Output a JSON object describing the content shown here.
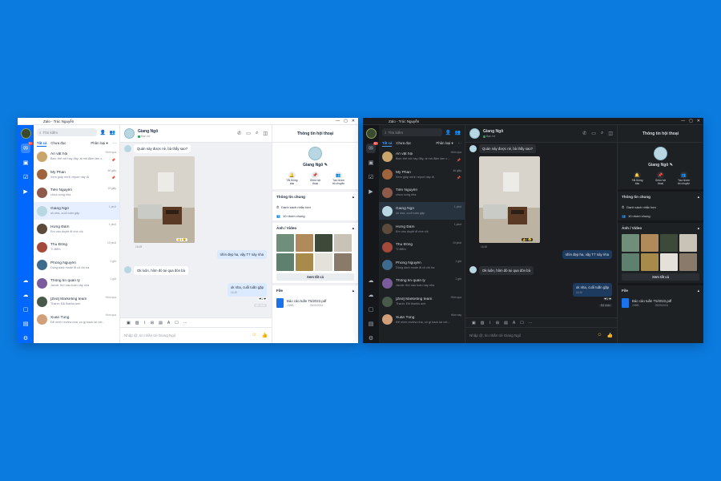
{
  "app_title": "Zalo - Trúc Nguyễn",
  "search_placeholder": "Tìm kiếm",
  "tabs": {
    "all": "Tất cả",
    "unread": "Chưa đọc",
    "classify": "Phân loại"
  },
  "light_conversations": [
    {
      "name": "Ăn vặt hội",
      "preview": "Bạn: thế nói hay đây, ai mà đâm làm c...",
      "time": "Hôm qua",
      "pinned": true,
      "avatar": "#c9a56b"
    },
    {
      "name": "My Phan",
      "preview": "Xem giúp mình report này đi",
      "time": "46 giây",
      "pinned": true,
      "avatar": "#a0643c"
    },
    {
      "name": "Tiến Nguyễn",
      "preview": "chưa xong nha",
      "time": "19 giây",
      "pinned": false,
      "avatar": "#8e5a4a"
    },
    {
      "name": "Giang Ngô",
      "preview": "ok nha, cuối tuần gặp",
      "time": "1 phút",
      "pinned": false,
      "avatar": "#b9d7e2",
      "active": true
    },
    {
      "name": "Hưng Đàm",
      "preview": "Em vào duyệt đi nhé chị",
      "time": "1 phút",
      "pinned": false,
      "avatar": "#5c4b3c"
    },
    {
      "name": "Thu Đồng",
      "preview": "Tí điểm",
      "time": "10 phút",
      "pinned": false,
      "avatar": "#a34a3c"
    },
    {
      "name": "Phong Nguyễn",
      "preview": "Dùng dark mode đi cô chị ba",
      "time": "1 giờ",
      "pinned": false,
      "avatar": "#3e6a8c"
    },
    {
      "name": "Thông tin quản lý",
      "preview": "Jacob: thứ sáu tuần này nha",
      "time": "1 giờ",
      "pinned": false,
      "avatar": "#7a5c9c"
    },
    {
      "name": "[Zed] Marketing team",
      "preview": "Thanh: Đã thanks anh",
      "time": "Hôm qua",
      "pinned": false,
      "avatar": "#4a5a4a"
    },
    {
      "name": "Xuân Tùng",
      "preview": "Để mình review nha, có gì back lại với...",
      "time": "Hôm qua",
      "pinned": false,
      "avatar": "#d1a07a"
    }
  ],
  "dark_conversations": [
    {
      "name": "Ăn vặt hội",
      "preview": "Bạn: thế nói hay đây, ai mà đâm làm c...",
      "time": "Hôm qua",
      "pinned": true,
      "avatar": "#c9a56b"
    },
    {
      "name": "My Phan",
      "preview": "Xem giúp mình report này đi",
      "time": "46 giây",
      "pinned": true,
      "avatar": "#a0643c"
    },
    {
      "name": "Tiến Nguyễn",
      "preview": "chưa xong nha",
      "time": "",
      "pinned": false,
      "avatar": "#8e5a4a"
    },
    {
      "name": "Giang Ngô",
      "preview": "ok nha, cuối tuần gặp",
      "time": "1 phút",
      "pinned": false,
      "avatar": "#b9d7e2",
      "active": true
    },
    {
      "name": "Hưng Đàm",
      "preview": "Em vào duyệt đi nhé chị",
      "time": "1 phút",
      "pinned": false,
      "avatar": "#5c4b3c"
    },
    {
      "name": "Thu Đồng",
      "preview": "Tí điểm",
      "time": "10 phút",
      "pinned": false,
      "avatar": "#a34a3c"
    },
    {
      "name": "Phong Nguyễn",
      "preview": "Dùng dark mode đi cô chị ba",
      "time": "1 giờ",
      "pinned": false,
      "avatar": "#3e6a8c"
    },
    {
      "name": "Thông tin quản lý",
      "preview": "Jacob: thứ sáu tuần này nha",
      "time": "1 giờ",
      "pinned": false,
      "avatar": "#7a5c9c"
    },
    {
      "name": "[Zed] Marketing team",
      "preview": "Thanh: Đã thanks anh",
      "time": "Hôm qua",
      "pinned": false,
      "avatar": "#4a5a4a"
    },
    {
      "name": "Xuân Tùng",
      "preview": "Để mình review nha, có gì back lại với...",
      "time": "Hôm nay",
      "pinned": false,
      "avatar": "#d1a07a"
    }
  ],
  "chat": {
    "name": "Giang Ngô",
    "status": "Bạn bè",
    "msg_question": "Quán này được nè, bà thấy sao?",
    "photo_time": "16:48",
    "msg_out_1": "nhìn đẹp ha, vậy T7 này nha",
    "msg_in_2": "Ok luôn, hôm đó tui qua đón bà",
    "msg_out_2": "ok nha, cuối tuần gặp",
    "msg_out_2_time": "16:49",
    "reaction_count": "1",
    "seen": "Đã nhận",
    "composer_placeholder": "Nhập @, tin nhắn tới Giang Ngô"
  },
  "info": {
    "title": "Thông tin hội thoại",
    "name": "Giang Ngô",
    "actions": [
      "Tắt thông báo",
      "Ghim hội thoại",
      "Tạo nhóm trò chuyện"
    ],
    "general_title": "Thông tin chung",
    "reminder": "Danh sách nhắc hẹn",
    "common_groups": "10 nhóm chung",
    "media_title": "Ảnh / Video",
    "see_all": "Xem tất cả",
    "file_title": "File",
    "file_name": "Báo cáo tuần T5/2022.pdf",
    "file_size": "20MB",
    "file_date": "25/05/2024"
  },
  "thumb_colors": [
    "#6f8f7a",
    "#b08a5a",
    "#3d4a3a",
    "#c9c2b6",
    "#5f7f6f",
    "#a88a4a",
    "#e3e1d9",
    "#8a7a6a"
  ],
  "colors": {
    "brand": "#0068ff",
    "desktop": "#0b7be0"
  }
}
